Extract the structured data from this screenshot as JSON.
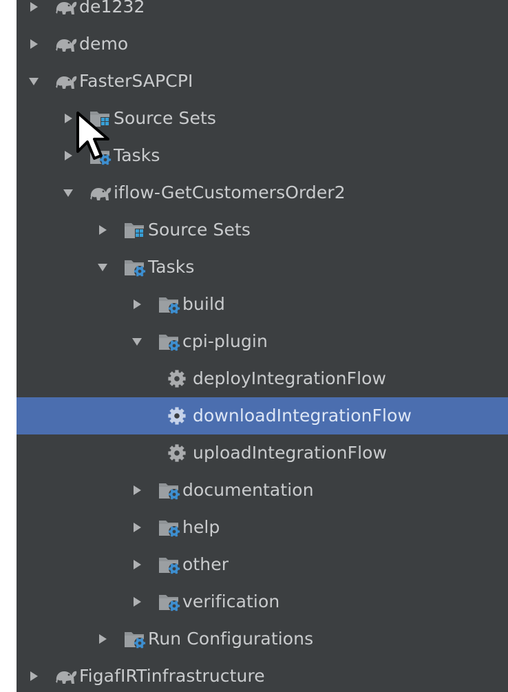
{
  "tree": {
    "rows": [
      {
        "label": "de1232",
        "kind": "project",
        "arrow": "collapsed",
        "depth": 0,
        "selected": false
      },
      {
        "label": "demo",
        "kind": "project",
        "arrow": "collapsed",
        "depth": 0,
        "selected": false
      },
      {
        "label": "FasterSAPCPI",
        "kind": "project",
        "arrow": "expanded",
        "depth": 0,
        "selected": false
      },
      {
        "label": "Source Sets",
        "kind": "source-sets",
        "arrow": "collapsed",
        "depth": 1,
        "selected": false
      },
      {
        "label": "Tasks",
        "kind": "tasks",
        "arrow": "collapsed",
        "depth": 1,
        "selected": false
      },
      {
        "label": "iflow-GetCustomersOrder2",
        "kind": "project",
        "arrow": "expanded",
        "depth": 1,
        "selected": false
      },
      {
        "label": "Source Sets",
        "kind": "source-sets",
        "arrow": "collapsed",
        "depth": 2,
        "selected": false
      },
      {
        "label": "Tasks",
        "kind": "tasks",
        "arrow": "expanded",
        "depth": 2,
        "selected": false
      },
      {
        "label": "build",
        "kind": "tasks",
        "arrow": "collapsed",
        "depth": 3,
        "selected": false
      },
      {
        "label": "cpi-plugin",
        "kind": "tasks",
        "arrow": "expanded",
        "depth": 3,
        "selected": false
      },
      {
        "label": "deployIntegrationFlow",
        "kind": "task",
        "arrow": "none",
        "depth": 4,
        "selected": false
      },
      {
        "label": "downloadIntegrationFlow",
        "kind": "task",
        "arrow": "none",
        "depth": 4,
        "selected": true
      },
      {
        "label": "uploadIntegrationFlow",
        "kind": "task",
        "arrow": "none",
        "depth": 4,
        "selected": false
      },
      {
        "label": "documentation",
        "kind": "tasks",
        "arrow": "collapsed",
        "depth": 3,
        "selected": false
      },
      {
        "label": "help",
        "kind": "tasks",
        "arrow": "collapsed",
        "depth": 3,
        "selected": false
      },
      {
        "label": "other",
        "kind": "tasks",
        "arrow": "collapsed",
        "depth": 3,
        "selected": false
      },
      {
        "label": "verification",
        "kind": "tasks",
        "arrow": "collapsed",
        "depth": 3,
        "selected": false
      },
      {
        "label": "Run Configurations",
        "kind": "run-configs",
        "arrow": "collapsed",
        "depth": 2,
        "selected": false
      },
      {
        "label": "FigafIRTinfrastructure",
        "kind": "project",
        "arrow": "collapsed",
        "depth": 0,
        "selected": false
      }
    ]
  },
  "colors": {
    "panel_background": "#3c3f41",
    "selection": "#4b6eaf",
    "text": "#c9cbcd",
    "icon_gray": "#a9abad",
    "folder_gray": "#8f9396",
    "gradle_blue": "#3d8fd1",
    "source_set_blue": "#389fd6"
  },
  "icons": {
    "project": "gradle-elephant-icon",
    "source-sets": "source-sets-folder-icon",
    "tasks": "tasks-folder-icon",
    "task": "gear-icon",
    "run-configs": "run-configurations-folder-icon",
    "expanded": "chevron-down-icon",
    "collapsed": "chevron-right-icon",
    "cursor": "mouse-pointer-icon"
  }
}
